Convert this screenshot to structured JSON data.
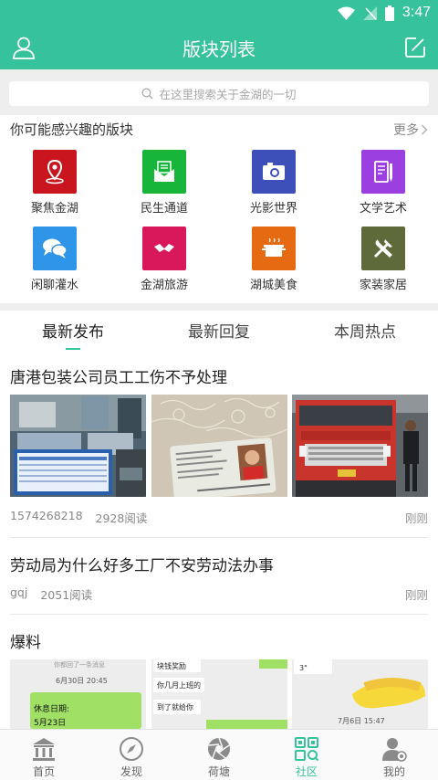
{
  "status_bar": {
    "time": "3:47",
    "icons": [
      "wifi-icon",
      "signal-off-icon",
      "battery-icon"
    ]
  },
  "header": {
    "title": "版块列表",
    "left_icon": "user-icon",
    "right_icon": "edit-icon"
  },
  "search": {
    "placeholder": "在这里搜索关于金湖的一切",
    "icon": "search-icon"
  },
  "interest": {
    "title": "你可能感兴趣的版块",
    "more_label": "更多",
    "boards": [
      {
        "label": "聚焦金湖",
        "color": "#c9161e",
        "icon": "location-pin-icon"
      },
      {
        "label": "民生通道",
        "color": "#17b53a",
        "icon": "mail-icon"
      },
      {
        "label": "光影世界",
        "color": "#3d4fb8",
        "icon": "camera-icon"
      },
      {
        "label": "文学艺术",
        "color": "#9b3fe0",
        "icon": "notebook-pen-icon"
      },
      {
        "label": "闲聊灌水",
        "color": "#2f95e8",
        "icon": "chat-bubbles-icon"
      },
      {
        "label": "金湖旅游",
        "color": "#d8185a",
        "icon": "travel-icon"
      },
      {
        "label": "湖城美食",
        "color": "#e66a12",
        "icon": "cooking-pot-icon"
      },
      {
        "label": "家装家居",
        "color": "#5e6a3a",
        "icon": "tools-icon"
      }
    ]
  },
  "tabs": [
    {
      "label": "最新发布",
      "active": true
    },
    {
      "label": "最新回复",
      "active": false
    },
    {
      "label": "本周热点",
      "active": false
    }
  ],
  "posts": [
    {
      "title": "唐港包装公司员工工伤不予处理",
      "author": "1574268218",
      "reads": "2928阅读",
      "time": "刚刚",
      "images": [
        "hospital-photo",
        "id-card-photo",
        "truck-photo"
      ]
    },
    {
      "title": "劳动局为什么好多工厂不安劳动法办事",
      "author": "gqj",
      "reads": "2051阅读",
      "time": "刚刚",
      "images": []
    },
    {
      "title": "爆料",
      "images": [
        "chat-screenshot-1",
        "chat-screenshot-2",
        "chat-screenshot-3"
      ],
      "image_texts": {
        "a_date": "6月30日 20:45",
        "a_rest": "休息日期:",
        "a_day": "5月23日",
        "a_top": "你都回了一条消息",
        "b_top": "块钱奖励",
        "b_q": "你几月上班的",
        "b_a": "到了就给你",
        "c_voice": "3\"",
        "c_date": "7月6日 15:47"
      }
    }
  ],
  "bottom_nav": [
    {
      "label": "首页",
      "icon": "home-icon",
      "active": false
    },
    {
      "label": "发现",
      "icon": "compass-icon",
      "active": false
    },
    {
      "label": "荷塘",
      "icon": "aperture-icon",
      "active": false
    },
    {
      "label": "社区",
      "icon": "community-grid-icon",
      "active": true
    },
    {
      "label": "我的",
      "icon": "profile-icon",
      "active": false
    }
  ],
  "colors": {
    "primary": "#36c29b",
    "background_gray": "#eeeeee"
  }
}
